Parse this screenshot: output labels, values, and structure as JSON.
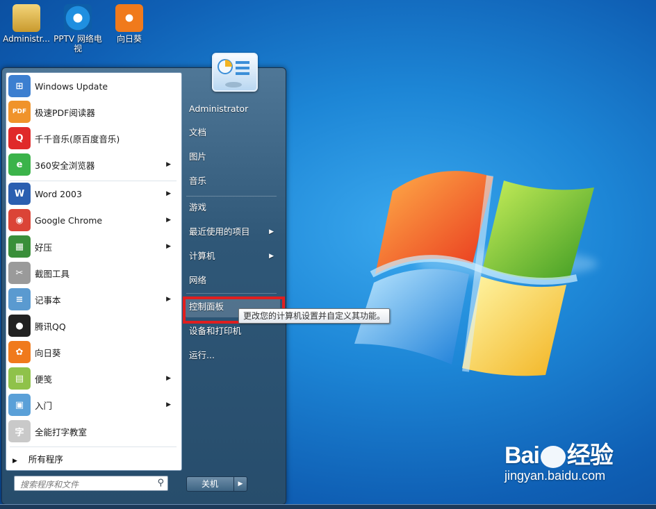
{
  "desktop_icons": [
    {
      "label": "Administr...",
      "icon": "folder-user-icon",
      "color": "#d9b24a"
    },
    {
      "label": "PPTV 网络电视",
      "icon": "pptv-icon",
      "color": "#1f8fe0"
    },
    {
      "label": "向日葵",
      "icon": "sunflower-icon",
      "color": "#f07a1c"
    }
  ],
  "start_menu": {
    "programs": [
      {
        "label": "Windows Update",
        "icon": "windows-update-icon",
        "color": "#3c7fd0",
        "glyph": "⊞",
        "submenu": false
      },
      {
        "label": "极速PDF阅读器",
        "icon": "pdf-reader-icon",
        "color": "#f0932b",
        "glyph": "PDF",
        "submenu": false
      },
      {
        "label": "千千音乐(原百度音乐)",
        "icon": "music-icon",
        "color": "#e02a2a",
        "glyph": "Q",
        "submenu": false
      },
      {
        "label": "360安全浏览器",
        "icon": "browser-360-icon",
        "color": "#3bb34a",
        "glyph": "e",
        "submenu": true
      },
      {
        "label": "Word 2003",
        "icon": "word-icon",
        "color": "#2b5fb0",
        "glyph": "W",
        "submenu": true
      },
      {
        "label": "Google Chrome",
        "icon": "chrome-icon",
        "color": "#db4437",
        "glyph": "◉",
        "submenu": true
      },
      {
        "label": "好压",
        "icon": "haozip-icon",
        "color": "#3a8f3a",
        "glyph": "▦",
        "submenu": true
      },
      {
        "label": "截图工具",
        "icon": "snipping-tool-icon",
        "color": "#9a9a9a",
        "glyph": "✂",
        "submenu": false
      },
      {
        "label": "记事本",
        "icon": "notepad-icon",
        "color": "#5a9ad0",
        "glyph": "≡",
        "submenu": true
      },
      {
        "label": "腾讯QQ",
        "icon": "qq-icon",
        "color": "#222222",
        "glyph": "●",
        "submenu": false
      },
      {
        "label": "向日葵",
        "icon": "sunflower-icon",
        "color": "#f07a1c",
        "glyph": "✿",
        "submenu": false
      },
      {
        "label": "便笺",
        "icon": "sticky-notes-icon",
        "color": "#8fc24a",
        "glyph": "▤",
        "submenu": true
      },
      {
        "label": "入门",
        "icon": "getting-started-icon",
        "color": "#5aa0d8",
        "glyph": "▣",
        "submenu": true
      },
      {
        "label": "全能打字教室",
        "icon": "typing-icon",
        "color": "#c9c9c9",
        "glyph": "字",
        "submenu": false
      }
    ],
    "all_programs": "所有程序",
    "search_placeholder": "搜索程序和文件",
    "right_items": [
      {
        "label": "Administrator",
        "submenu": false
      },
      {
        "label": "文档",
        "submenu": false
      },
      {
        "label": "图片",
        "submenu": false
      },
      {
        "label": "音乐",
        "submenu": false
      },
      {
        "label": "游戏",
        "submenu": false
      },
      {
        "label": "最近使用的项目",
        "submenu": true
      },
      {
        "label": "计算机",
        "submenu": true
      },
      {
        "label": "网络",
        "submenu": false
      },
      {
        "label": "控制面板",
        "submenu": false
      },
      {
        "label": "设备和打印机",
        "submenu": false
      },
      {
        "label": "运行...",
        "submenu": false
      }
    ],
    "shutdown_label": "关机",
    "tooltip": "更改您的计算机设置并自定义其功能。"
  },
  "watermark": {
    "brand_left": "Bai",
    "brand_right": "经验",
    "url": "jingyan.baidu.com"
  }
}
